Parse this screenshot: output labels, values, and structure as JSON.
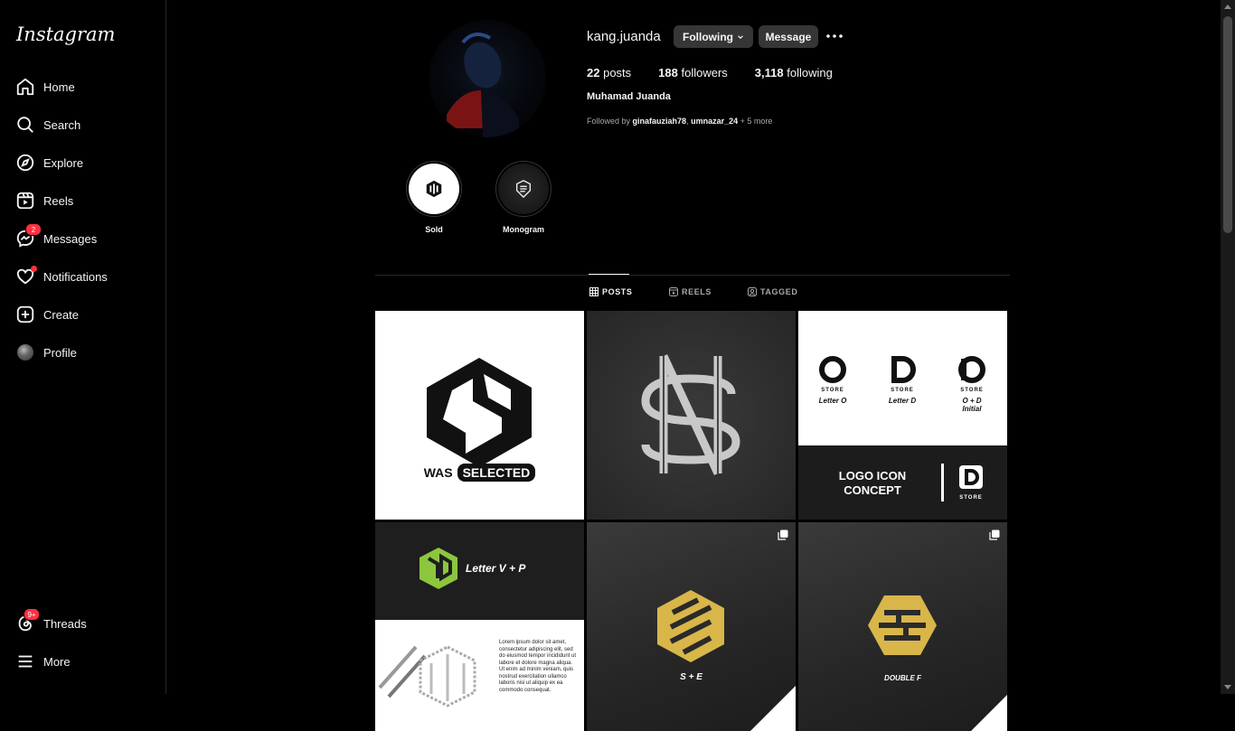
{
  "sidebar": {
    "logo": "Instagram",
    "items": [
      {
        "label": "Home"
      },
      {
        "label": "Search"
      },
      {
        "label": "Explore"
      },
      {
        "label": "Reels"
      },
      {
        "label": "Messages",
        "badge": "2"
      },
      {
        "label": "Notifications"
      },
      {
        "label": "Create"
      },
      {
        "label": "Profile"
      }
    ],
    "threads": {
      "label": "Threads",
      "badge": "9+"
    },
    "more": {
      "label": "More"
    }
  },
  "profile": {
    "username": "kang.juanda",
    "following_button": "Following",
    "message_button": "Message",
    "posts_count": "22",
    "posts_label": "posts",
    "followers_count": "188",
    "followers_label": "followers",
    "following_count": "3,118",
    "following_label": "following",
    "full_name": "Muhamad Juanda",
    "followed_by_prefix": "Followed by",
    "followed_by_1": "ginafauziah78",
    "followed_by_sep": ",",
    "followed_by_2": "umnazar_24",
    "followed_by_more": "+ 5 more"
  },
  "highlights": [
    {
      "label": "Sold"
    },
    {
      "label": "Monogram"
    }
  ],
  "tabs": [
    {
      "label": "POSTS",
      "active": true
    },
    {
      "label": "REELS",
      "active": false
    },
    {
      "label": "TAGGED",
      "active": false
    }
  ],
  "posts": [
    {
      "text": "WAS",
      "badge": "SELECTED"
    },
    {
      "text": ""
    },
    {
      "items": [
        {
          "store": "STORE",
          "caption": "Letter O"
        },
        {
          "store": "STORE",
          "caption": "Letter D"
        },
        {
          "store": "STORE",
          "caption": "O + D",
          "caption2": "Initial"
        }
      ],
      "title_line1": "LOGO ICON",
      "title_line2": "CONCEPT",
      "store": "STORE"
    },
    {
      "title": "Letter V + P",
      "lorem": "Lorem ipsum dolor sit amet, consectetur adipiscing elit, sed do eiusmod tempor incididunt ut labore et dolore magna aliqua. Ut enim ad minim veniam, quis nostrud exercitation ullamco laboris nisi ut aliquip ex ea commodo consequat."
    },
    {
      "caption": "S + E"
    },
    {
      "caption": "DOUBLE F"
    }
  ],
  "colors": {
    "background": "#000000",
    "notification_red": "#ff3040",
    "button_gray": "#363636",
    "gold": "#d9b64a",
    "green": "#8cc63f"
  }
}
